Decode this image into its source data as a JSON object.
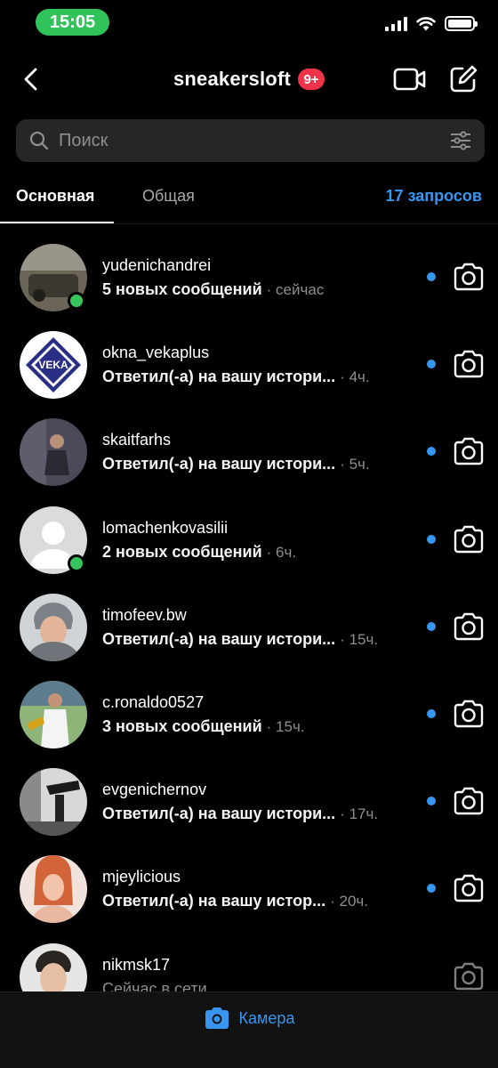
{
  "status_bar": {
    "time": "15:05"
  },
  "header": {
    "title": "sneakersloft",
    "badge": "9+"
  },
  "search": {
    "placeholder": "Поиск"
  },
  "tabs": {
    "main": "Основная",
    "general": "Общая",
    "requests": "17 запросов"
  },
  "conversations": [
    {
      "username": "yudenichandrei",
      "preview": "5 новых сообщений",
      "time": "· сейчас",
      "online": true,
      "unread": true
    },
    {
      "username": "okna_vekaplus",
      "preview": "Ответил(-а) на вашу истори...",
      "time": "· 4ч.",
      "online": false,
      "unread": true,
      "avatar_text": "VEKA"
    },
    {
      "username": "skaitfarhs",
      "preview": "Ответил(-а) на вашу истори...",
      "time": "· 5ч.",
      "online": false,
      "unread": true
    },
    {
      "username": "lomachenkovasilii",
      "preview": "2 новых сообщений",
      "time": "· 6ч.",
      "online": true,
      "unread": true
    },
    {
      "username": "timofeev.bw",
      "preview": "Ответил(-а) на вашу истори...",
      "time": "· 15ч.",
      "online": false,
      "unread": true
    },
    {
      "username": "c.ronaldo0527",
      "preview": "3 новых сообщений",
      "time": "· 15ч.",
      "online": false,
      "unread": true
    },
    {
      "username": "evgenichernov",
      "preview": "Ответил(-а) на вашу истори...",
      "time": "· 17ч.",
      "online": false,
      "unread": true
    },
    {
      "username": "mjeylicious",
      "preview": "Ответил(-а) на вашу истор...",
      "time": "· 20ч.",
      "online": false,
      "unread": true
    },
    {
      "username": "nikmsk17",
      "preview": "Сейчас в сети",
      "time": "",
      "online": false,
      "unread": false
    }
  ],
  "bottom": {
    "camera_label": "Камера"
  },
  "colors": {
    "accent": "#3797f0",
    "badge": "#ef3449",
    "online": "#37c45a",
    "time_pill": "#2fc35a"
  }
}
